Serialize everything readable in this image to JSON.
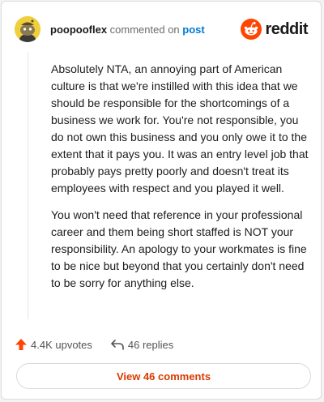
{
  "comment": {
    "username": "poopooflex",
    "action_text": "commented on",
    "target_link": "post",
    "paragraphs": [
      "Absolutely NTA, an annoying part of American culture is that we're instilled with this idea that we should be responsible for the shortcomings of a business we work for. You're not responsible, you do not own this business and you only owe it to the extent that it pays you. It was an entry level job that probably pays pretty poorly and doesn't treat its employees with respect and you played it well.",
      "You won't need that reference in your professional career and them being short staffed is NOT your responsibility. An apology to your workmates is fine to be nice but beyond that you certainly don't need to be sorry for anything else."
    ]
  },
  "brand": {
    "name": "reddit",
    "accent": "#ff4500"
  },
  "actions": {
    "upvotes": "4.4K upvotes",
    "replies": "46 replies",
    "upvote_color": "#ff4500"
  },
  "footer": {
    "view_comments": "View 46 comments"
  },
  "icons": {
    "avatar": "snoo-avatar-icon",
    "logo": "reddit-logo-icon",
    "upvote": "upvote-arrow-icon",
    "reply": "reply-arrow-icon"
  }
}
